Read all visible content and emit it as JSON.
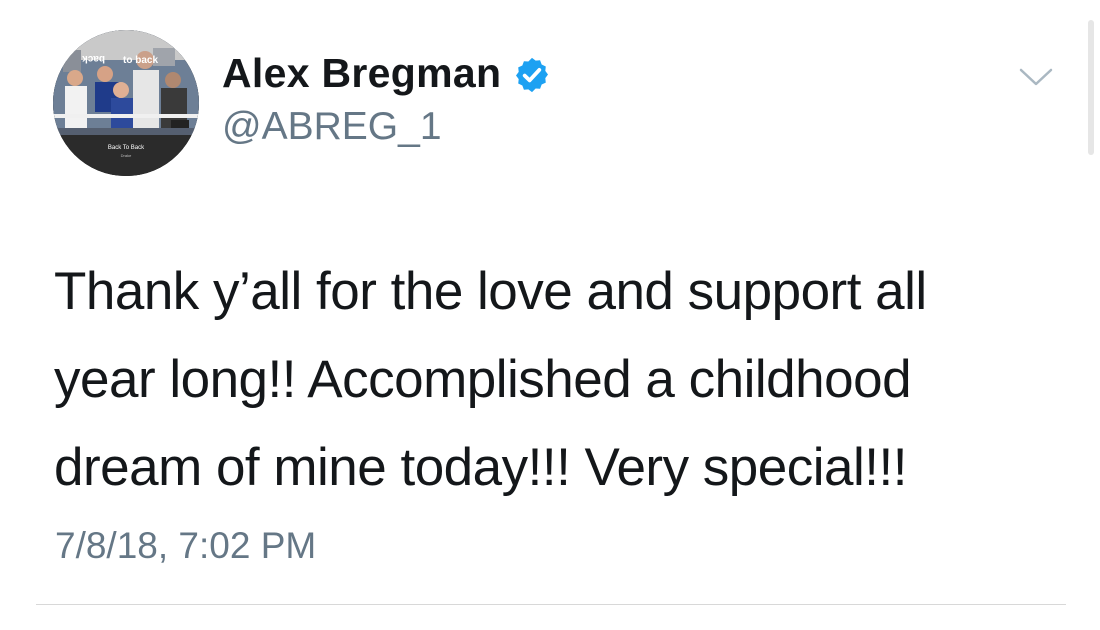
{
  "user": {
    "display_name": "Alex Bregman",
    "handle": "@ABREG_1",
    "verified": true,
    "avatar_banner_text": "back to back",
    "avatar_caption_title": "Back To Back",
    "avatar_caption_artist": "Drake"
  },
  "tweet": {
    "text_lines": [
      "Thank y’all for the love and support all",
      "year long!! Accomplished a childhood",
      "dream of mine today!!! Very special!!!"
    ],
    "timestamp": "7/8/18, 7:02 PM"
  },
  "icons": {
    "verified": "verified-badge-icon",
    "menu": "chevron-down-icon"
  },
  "colors": {
    "text": "#14171a",
    "secondary_text": "#657786",
    "verified_blue": "#1da1f2",
    "divider": "#d8d8d8"
  }
}
